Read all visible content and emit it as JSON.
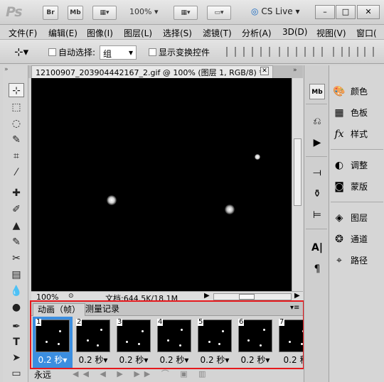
{
  "app": {
    "logo": "Ps",
    "bridge_label": "Br",
    "minibridge_label": "Mb",
    "zoom": "100%",
    "cslive_label": "CS Live",
    "minimize_glyph": "–",
    "restore_glyph": "□",
    "close_glyph": "✕"
  },
  "menu": [
    "文件(F)",
    "编辑(E)",
    "图像(I)",
    "图层(L)",
    "选择(S)",
    "滤镜(T)",
    "分析(A)",
    "3D(D)",
    "视图(V)",
    "窗口("
  ],
  "options": {
    "auto_select_label": "自动选择:",
    "group_value": "组",
    "show_transform_label": "显示变换控件"
  },
  "document": {
    "tab_title": "12100907_203904442167_2.gif @ 100% (图层 1, RGB/8) *",
    "zoom_status": "100%",
    "doc_info": "文档:644.5K/18.1M"
  },
  "animation": {
    "tab_animation": "动画（帧）",
    "tab_measure": "测量记录",
    "frames": [
      {
        "num": "1",
        "time": "0.2 秒▾",
        "selected": true
      },
      {
        "num": "2",
        "time": "0.2 秒▾",
        "selected": false
      },
      {
        "num": "3",
        "time": "0.2 秒▾",
        "selected": false
      },
      {
        "num": "4",
        "time": "0.2 秒▾",
        "selected": false
      },
      {
        "num": "5",
        "time": "0.2 秒▾",
        "selected": false
      },
      {
        "num": "6",
        "time": "0.2 秒▾",
        "selected": false
      },
      {
        "num": "7",
        "time": "0.2 秒",
        "selected": false
      }
    ],
    "loop_value": "永远"
  },
  "panels": [
    {
      "label": "颜色",
      "icon": "palette-icon"
    },
    {
      "label": "色板",
      "icon": "swatches-icon"
    },
    {
      "label": "样式",
      "icon": "styles-icon"
    },
    {
      "label": "调整",
      "icon": "adjustments-icon"
    },
    {
      "label": "蒙版",
      "icon": "masks-icon"
    },
    {
      "label": "图层",
      "icon": "layers-icon"
    },
    {
      "label": "通道",
      "icon": "channels-icon"
    },
    {
      "label": "路径",
      "icon": "paths-icon"
    }
  ],
  "colors": {
    "highlight_red": "#e5181c",
    "selected_frame": "#3b8ee0"
  }
}
